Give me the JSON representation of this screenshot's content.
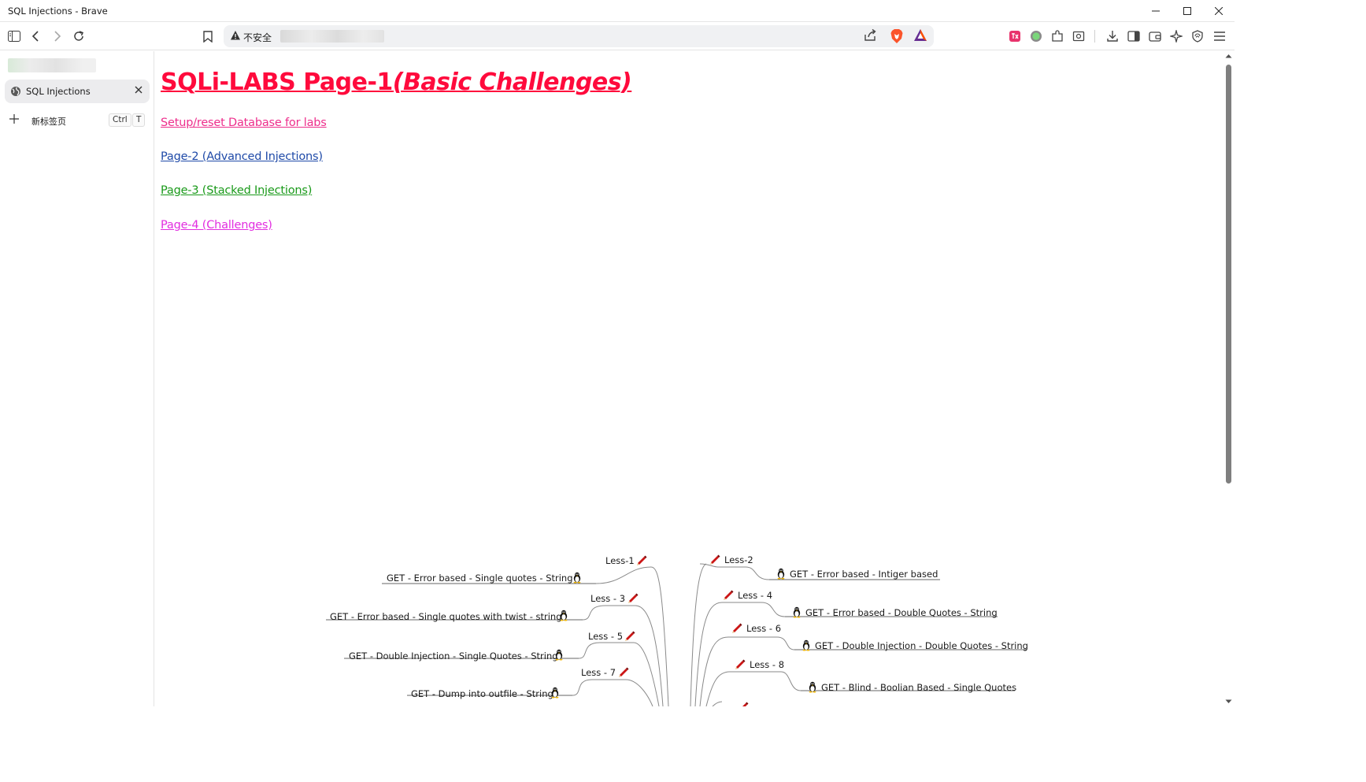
{
  "window": {
    "title": "SQL Injections - Brave"
  },
  "toolbar": {
    "security_label": "不安全",
    "icons": [
      "sidebar-toggle-icon",
      "back-icon",
      "forward-icon",
      "reload-icon",
      "bookmark-icon",
      "warning-icon",
      "share-icon",
      "brave-shields-icon",
      "brave-rewards-icon",
      "extension-pink-icon",
      "extension-green-icon",
      "extensions-puzzle-icon",
      "reader-mode-icon",
      "download-icon",
      "side-panel-icon",
      "wallet-icon",
      "leo-ai-icon",
      "vpn-icon",
      "menu-icon"
    ]
  },
  "sidebar": {
    "tabs": [
      {
        "label": "SQL Injections"
      }
    ],
    "new_tab": {
      "label": "新标签页",
      "key1": "Ctrl",
      "key2": "T"
    }
  },
  "page": {
    "title_main": "SQLi-LABS Page-1",
    "title_sub": "(Basic Challenges)",
    "links": [
      {
        "label": "Setup/reset Database for labs"
      },
      {
        "label": "Page-2 (Advanced Injections)"
      },
      {
        "label": "Page-3 (Stacked Injections)"
      },
      {
        "label": "Page-4 (Challenges)"
      }
    ]
  },
  "mindmap": {
    "left": [
      {
        "lesson": "Less-1",
        "description": "GET - Error based - Single quotes - String"
      },
      {
        "lesson": "Less - 3",
        "description": "GET - Error based - Single quotes with twist - string"
      },
      {
        "lesson": "Less - 5",
        "description": "GET - Double Injection - Single Quotes - String"
      },
      {
        "lesson": "Less - 7",
        "description": "GET - Dump into outfile - String"
      }
    ],
    "right": [
      {
        "lesson": "Less-2",
        "description": "GET - Error based - Intiger based"
      },
      {
        "lesson": "Less - 4",
        "description": "GET - Error based - Double Quotes - String"
      },
      {
        "lesson": "Less - 6",
        "description": "GET - Double Injection - Double Quotes - String"
      },
      {
        "lesson": "Less - 8",
        "description": "GET - Blind - Boolian Based - Single Quotes"
      }
    ]
  }
}
